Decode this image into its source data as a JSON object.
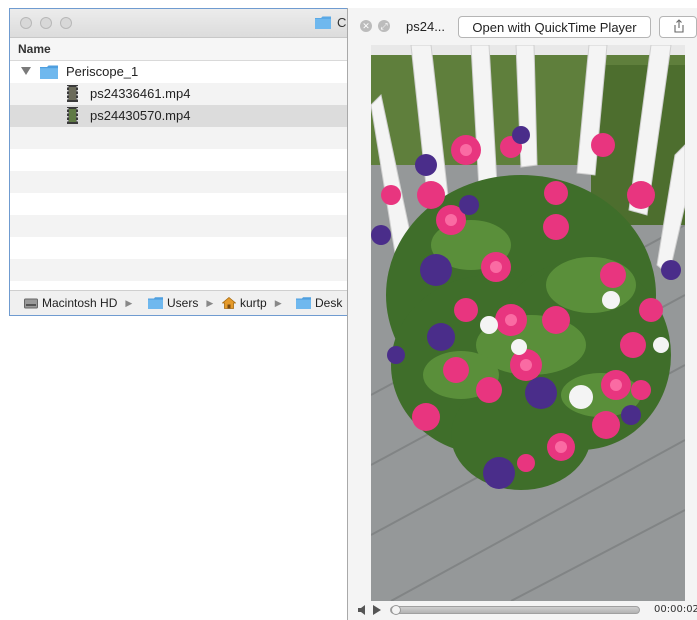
{
  "finder": {
    "title_fragment": "C",
    "column_header": "Name",
    "folder": {
      "name": "Periscope_1",
      "expanded": true
    },
    "files": [
      {
        "name": "ps24336461.mp4",
        "selected": false
      },
      {
        "name": "ps24430570.mp4",
        "selected": true
      }
    ],
    "path": [
      {
        "label": "Macintosh HD",
        "icon": "hard-drive-icon"
      },
      {
        "label": "Users",
        "icon": "folder-icon"
      },
      {
        "label": "kurtp",
        "icon": "home-icon"
      },
      {
        "label": "Desk",
        "icon": "folder-icon"
      }
    ]
  },
  "quicklook": {
    "filename": "ps24...",
    "open_button": "Open with QuickTime Player",
    "share_icon": "share-icon",
    "close_icon": "close-icon",
    "fullscreen_icon": "fullscreen-icon",
    "video_subject": "potted petunias on a porch deck",
    "timecode": "00:00:02",
    "progress": 0.0
  },
  "colors": {
    "selection": "#dcdcdc",
    "folder_blue": "#5aa9e6",
    "window_border": "#6f9bd0"
  }
}
